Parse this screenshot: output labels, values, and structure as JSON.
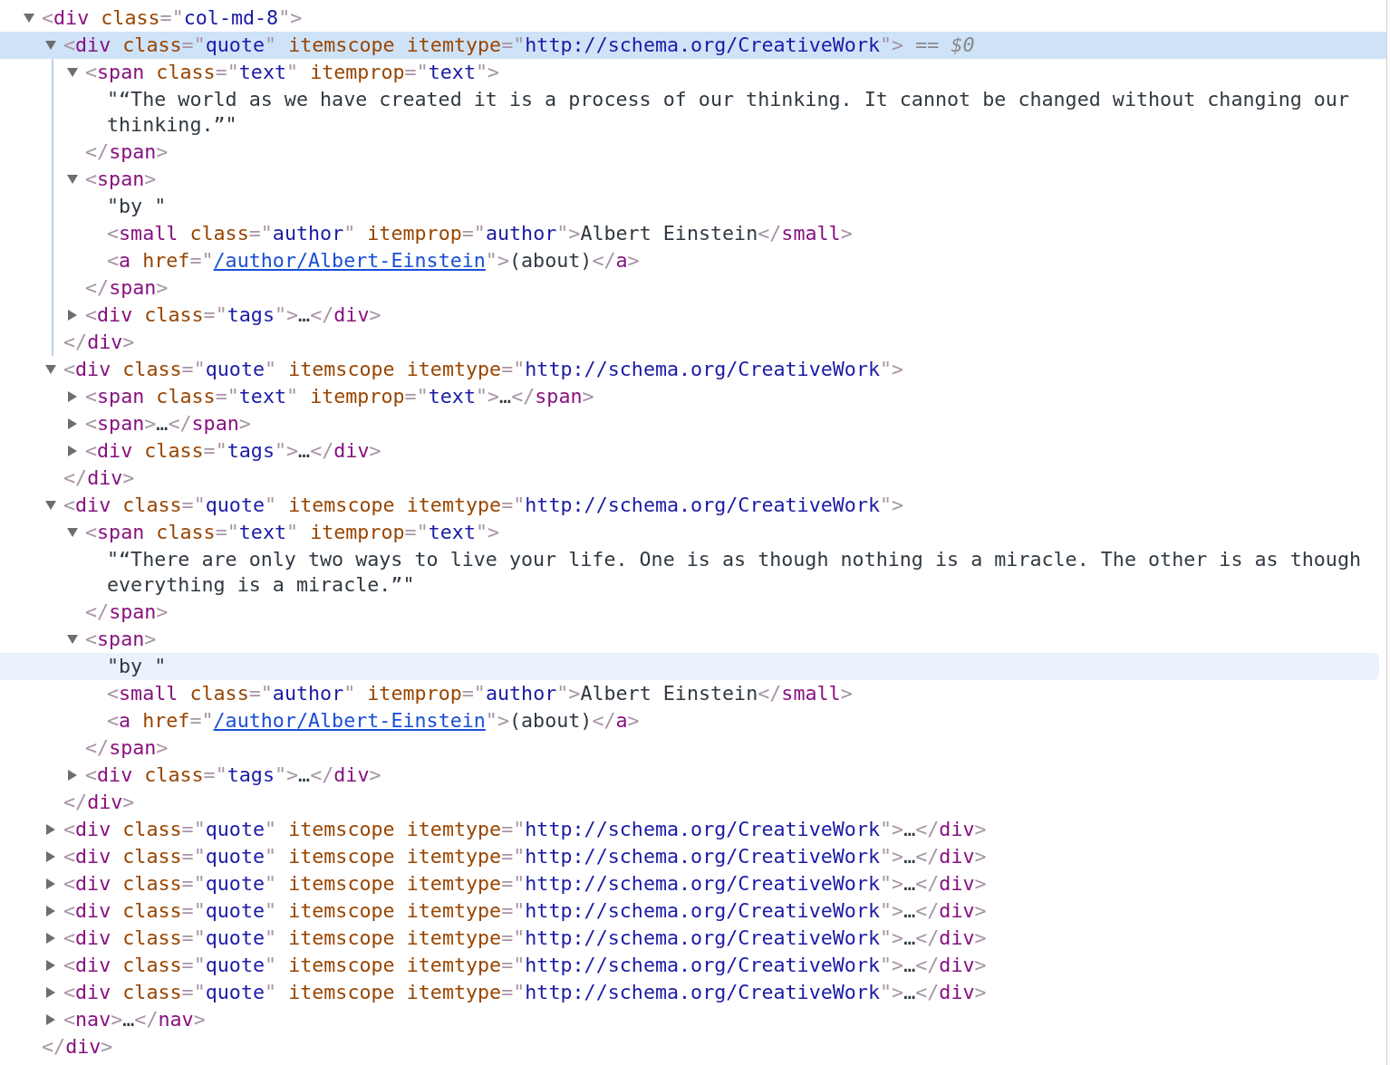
{
  "syntax": {
    "open": "<",
    "close": ">",
    "end_open": "</",
    "eq": "=",
    "quote": "\"",
    "ellipsis": "…",
    "selected_marker": "== $0"
  },
  "dom_tree": {
    "tag": "div",
    "attrs": [
      {
        "name": "class",
        "value": "col-md-8"
      }
    ],
    "expanded": true,
    "selected": false,
    "children": [
      {
        "tag": "div",
        "attrs": [
          {
            "name": "class",
            "value": "quote"
          },
          {
            "name": "itemscope"
          },
          {
            "name": "itemtype",
            "value": "http://schema.org/CreativeWork"
          }
        ],
        "expanded": true,
        "selected": true,
        "children": [
          {
            "tag": "span",
            "attrs": [
              {
                "name": "class",
                "value": "text"
              },
              {
                "name": "itemprop",
                "value": "text"
              }
            ],
            "expanded": true,
            "selected": false,
            "children": [
              {
                "kind": "text",
                "text": "“The world as we have created it is a process of our thinking. It cannot be changed without changing our thinking.”",
                "hovered": false
              }
            ],
            "end_tag": "span"
          },
          {
            "tag": "span",
            "expanded": true,
            "selected": false,
            "children": [
              {
                "kind": "text",
                "text": "by ",
                "hovered": false
              },
              {
                "tag": "small",
                "attrs": [
                  {
                    "name": "class",
                    "value": "author"
                  },
                  {
                    "name": "itemprop",
                    "value": "author"
                  }
                ],
                "text": "Albert Einstein",
                "selected": false,
                "end_tag": "small"
              },
              {
                "tag": "a",
                "attrs": [
                  {
                    "name": "href",
                    "value": "/author/Albert-Einstein",
                    "link": true
                  }
                ],
                "text": "(about)",
                "selected": false,
                "end_tag": "a"
              }
            ],
            "end_tag": "span"
          },
          {
            "tag": "div",
            "attrs": [
              {
                "name": "class",
                "value": "tags"
              }
            ],
            "expanded": false,
            "selected": false,
            "end_tag": "div"
          }
        ],
        "end_tag": "div"
      },
      {
        "tag": "div",
        "attrs": [
          {
            "name": "class",
            "value": "quote"
          },
          {
            "name": "itemscope"
          },
          {
            "name": "itemtype",
            "value": "http://schema.org/CreativeWork"
          }
        ],
        "expanded": true,
        "selected": false,
        "children": [
          {
            "tag": "span",
            "attrs": [
              {
                "name": "class",
                "value": "text"
              },
              {
                "name": "itemprop",
                "value": "text"
              }
            ],
            "expanded": false,
            "selected": false,
            "end_tag": "span"
          },
          {
            "tag": "span",
            "expanded": false,
            "selected": false,
            "end_tag": "span"
          },
          {
            "tag": "div",
            "attrs": [
              {
                "name": "class",
                "value": "tags"
              }
            ],
            "expanded": false,
            "selected": false,
            "end_tag": "div"
          }
        ],
        "end_tag": "div"
      },
      {
        "tag": "div",
        "attrs": [
          {
            "name": "class",
            "value": "quote"
          },
          {
            "name": "itemscope"
          },
          {
            "name": "itemtype",
            "value": "http://schema.org/CreativeWork"
          }
        ],
        "expanded": true,
        "selected": false,
        "children": [
          {
            "tag": "span",
            "attrs": [
              {
                "name": "class",
                "value": "text"
              },
              {
                "name": "itemprop",
                "value": "text"
              }
            ],
            "expanded": true,
            "selected": false,
            "children": [
              {
                "kind": "text",
                "text": "“There are only two ways to live your life. One is as though nothing is a miracle. The other is as though everything is a miracle.”",
                "hovered": false
              }
            ],
            "end_tag": "span"
          },
          {
            "tag": "span",
            "expanded": true,
            "selected": false,
            "children": [
              {
                "kind": "text",
                "text": "by ",
                "hovered": true
              },
              {
                "tag": "small",
                "attrs": [
                  {
                    "name": "class",
                    "value": "author"
                  },
                  {
                    "name": "itemprop",
                    "value": "author"
                  }
                ],
                "text": "Albert Einstein",
                "selected": false,
                "end_tag": "small"
              },
              {
                "tag": "a",
                "attrs": [
                  {
                    "name": "href",
                    "value": "/author/Albert-Einstein",
                    "link": true
                  }
                ],
                "text": "(about)",
                "selected": false,
                "end_tag": "a"
              }
            ],
            "end_tag": "span"
          },
          {
            "tag": "div",
            "attrs": [
              {
                "name": "class",
                "value": "tags"
              }
            ],
            "expanded": false,
            "selected": false,
            "end_tag": "div"
          }
        ],
        "end_tag": "div"
      },
      {
        "tag": "div",
        "attrs": [
          {
            "name": "class",
            "value": "quote"
          },
          {
            "name": "itemscope"
          },
          {
            "name": "itemtype",
            "value": "http://schema.org/CreativeWork"
          }
        ],
        "expanded": false,
        "selected": false,
        "end_tag": "div"
      },
      {
        "tag": "div",
        "attrs": [
          {
            "name": "class",
            "value": "quote"
          },
          {
            "name": "itemscope"
          },
          {
            "name": "itemtype",
            "value": "http://schema.org/CreativeWork"
          }
        ],
        "expanded": false,
        "selected": false,
        "end_tag": "div"
      },
      {
        "tag": "div",
        "attrs": [
          {
            "name": "class",
            "value": "quote"
          },
          {
            "name": "itemscope"
          },
          {
            "name": "itemtype",
            "value": "http://schema.org/CreativeWork"
          }
        ],
        "expanded": false,
        "selected": false,
        "end_tag": "div"
      },
      {
        "tag": "div",
        "attrs": [
          {
            "name": "class",
            "value": "quote"
          },
          {
            "name": "itemscope"
          },
          {
            "name": "itemtype",
            "value": "http://schema.org/CreativeWork"
          }
        ],
        "expanded": false,
        "selected": false,
        "end_tag": "div"
      },
      {
        "tag": "div",
        "attrs": [
          {
            "name": "class",
            "value": "quote"
          },
          {
            "name": "itemscope"
          },
          {
            "name": "itemtype",
            "value": "http://schema.org/CreativeWork"
          }
        ],
        "expanded": false,
        "selected": false,
        "end_tag": "div"
      },
      {
        "tag": "div",
        "attrs": [
          {
            "name": "class",
            "value": "quote"
          },
          {
            "name": "itemscope"
          },
          {
            "name": "itemtype",
            "value": "http://schema.org/CreativeWork"
          }
        ],
        "expanded": false,
        "selected": false,
        "end_tag": "div"
      },
      {
        "tag": "div",
        "attrs": [
          {
            "name": "class",
            "value": "quote"
          },
          {
            "name": "itemscope"
          },
          {
            "name": "itemtype",
            "value": "http://schema.org/CreativeWork"
          }
        ],
        "expanded": false,
        "selected": false,
        "end_tag": "div"
      },
      {
        "tag": "nav",
        "expanded": false,
        "selected": false,
        "end_tag": "nav"
      }
    ],
    "end_tag": "div"
  }
}
